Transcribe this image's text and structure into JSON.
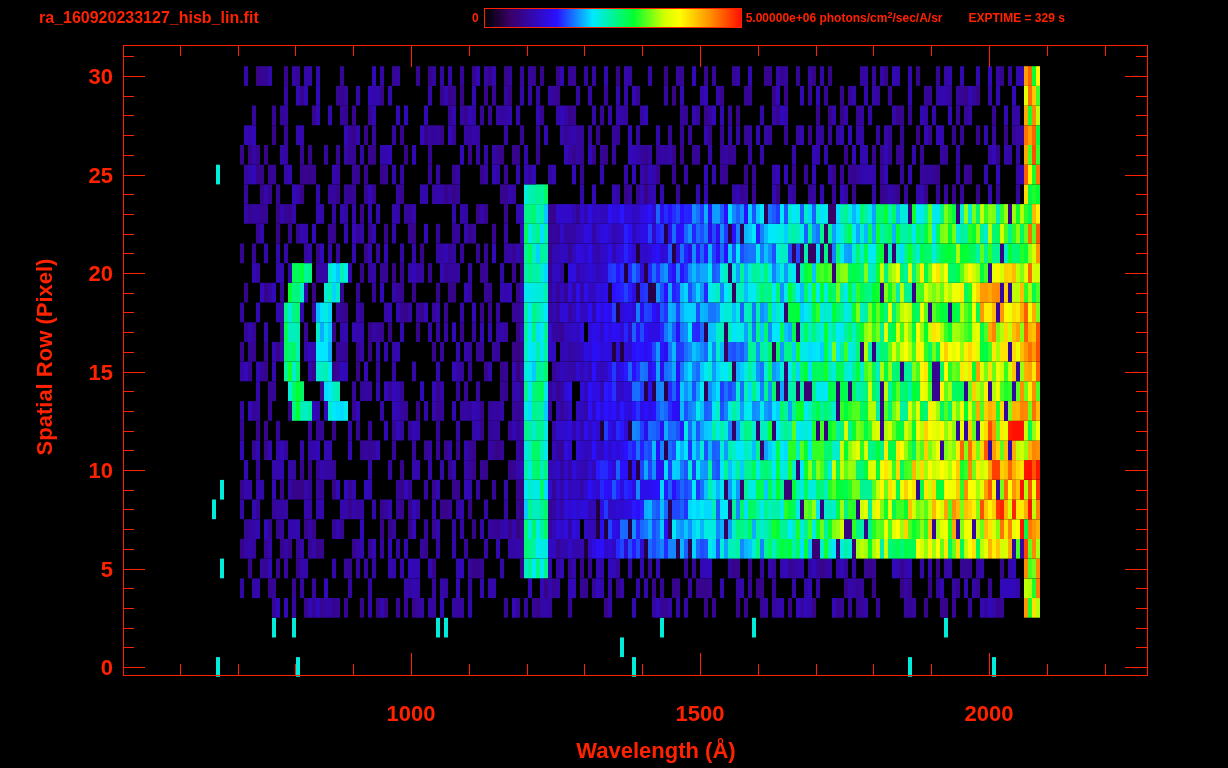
{
  "title": "ra_160920233127_hisb_lin.fit",
  "colorbar": {
    "min_label": "0",
    "max_label": "5.00000e+06 photons/cm$^{2}$/sec/A/sr"
  },
  "exptime": "EXPTIME = 329 s",
  "y_axis": {
    "label": "Spatial Row (Pixel)",
    "ticks": [
      "30",
      "25",
      "20",
      "15",
      "10",
      "5",
      "0"
    ]
  },
  "x_axis": {
    "label": "Wavelength (Å)",
    "ticks": [
      "1000",
      "1500",
      "2000"
    ]
  }
}
